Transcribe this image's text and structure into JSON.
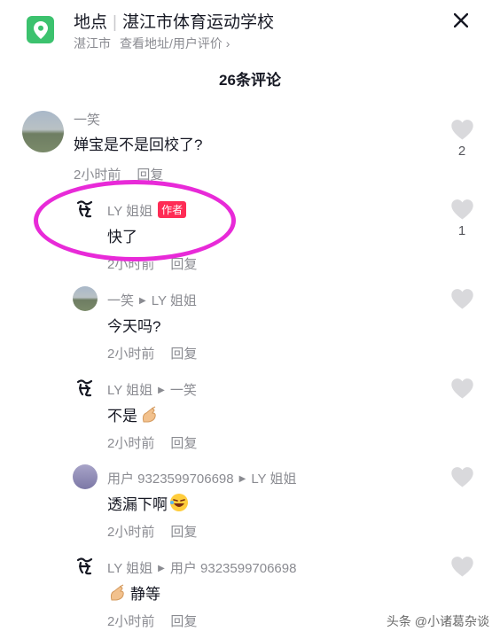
{
  "header": {
    "location_label": "地点",
    "location_name": "湛江市体育运动学校",
    "city": "湛江市",
    "address_link": "查看地址/用户评价",
    "comment_count": "26条评论"
  },
  "comments": [
    {
      "user": "一笑",
      "text": "婵宝是不是回校了?",
      "time": "2小时前",
      "reply_label": "回复",
      "likes": "2"
    },
    {
      "user": "LY 姐姐",
      "author_tag": "作者",
      "text": "快了",
      "time": "2小时前",
      "reply_label": "回复",
      "likes": "1"
    },
    {
      "user": "一笑",
      "reply_to": "LY 姐姐",
      "text": "今天吗?",
      "time": "2小时前",
      "reply_label": "回复"
    },
    {
      "user": "LY 姐姐",
      "reply_to": "一笑",
      "text": "不是",
      "time": "2小时前",
      "reply_label": "回复"
    },
    {
      "user": "用户 9323599706698",
      "reply_to": "LY 姐姐",
      "text": "透漏下啊",
      "time": "2小时前",
      "reply_label": "回复"
    },
    {
      "user": "LY 姐姐",
      "reply_to": "用户 9323599706698",
      "text": "静等",
      "time": "2小时前",
      "reply_label": "回复"
    }
  ],
  "watermark": "头条 @小诸葛杂谈",
  "colors": {
    "location_icon": "#3cc26e",
    "author_tag": "#fe2c55",
    "highlight_circle": "#e82ad8"
  }
}
